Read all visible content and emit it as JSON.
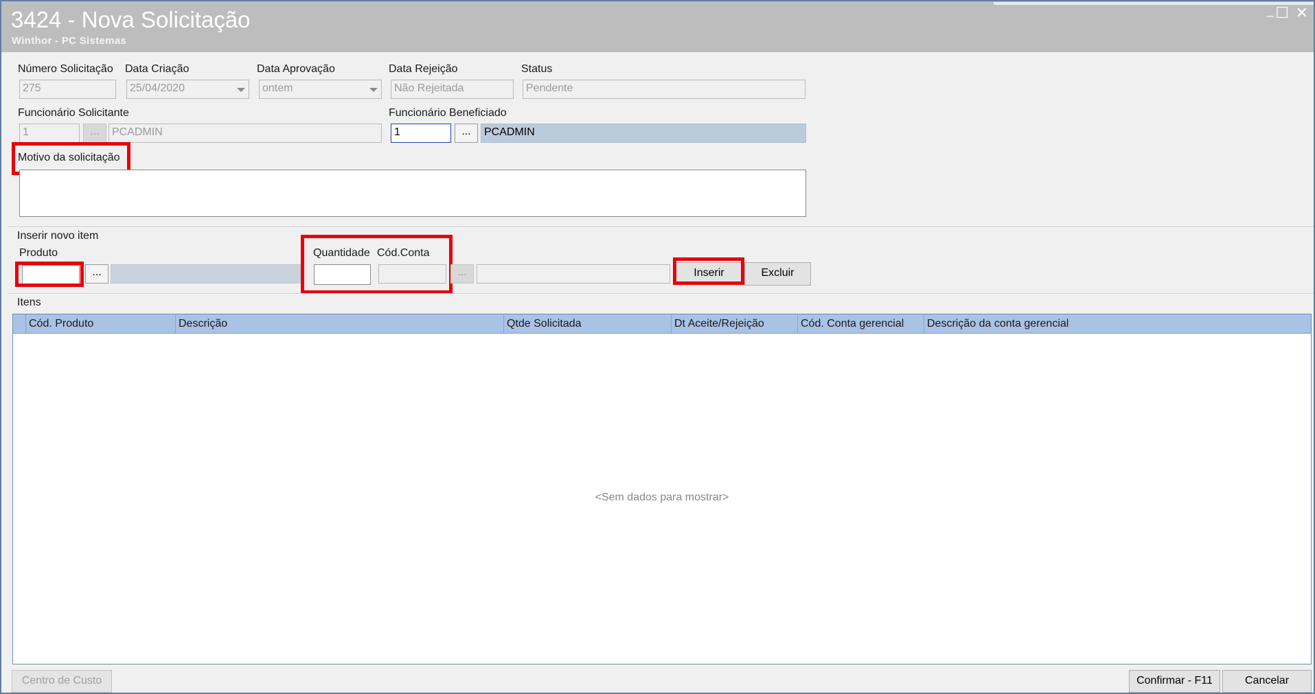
{
  "window": {
    "title": "3424 - Nova Solicitação",
    "subtitle": "Winthor - PC Sistemas",
    "min_glyph": "_",
    "max_glyph": "☐",
    "close_glyph": "✕"
  },
  "header": {
    "numero_label": "Número Solicitação",
    "numero_value": "275",
    "data_criacao_label": "Data Criação",
    "data_criacao_value": "25/04/2020",
    "data_aprovacao_label": "Data Aprovação",
    "data_aprovacao_value": "ontem",
    "data_rejeicao_label": "Data Rejeição",
    "data_rejeicao_value": "Não Rejeitada",
    "status_label": "Status",
    "status_value": "Pendente",
    "func_solicitante_label": "Funcionário Solicitante",
    "func_solicitante_code": "1",
    "func_solicitante_name": "PCADMIN",
    "func_beneficiado_label": "Funcionário Beneficiado",
    "func_beneficiado_code": "1",
    "func_beneficiado_name": "PCADMIN",
    "motivo_label": "Motivo da solicitação",
    "motivo_value": "",
    "lookup_glyph": "..."
  },
  "insert_item": {
    "group_label": "Inserir novo item",
    "produto_label": "Produto",
    "quantidade_label": "Quantidade",
    "cod_conta_label": "Cód.Conta",
    "inserir_button": "Inserir",
    "excluir_button": "Excluir"
  },
  "items": {
    "group_label": "Itens",
    "columns": [
      "Cód. Produto",
      "Descrição",
      "Qtde Solicitada",
      "Dt Aceite/Rejeição",
      "Cód. Conta gerencial",
      "Descrição da conta gerencial"
    ],
    "empty_message": "<Sem dados para mostrar>"
  },
  "footer": {
    "centro_custo_button": "Centro de Custo",
    "confirmar_button": "Confirmar - F11",
    "cancelar_button": "Cancelar"
  },
  "colors": {
    "highlight": "#e8000b",
    "grid_header": "#a9c2e6",
    "titlebar": "#bdbdbd"
  }
}
